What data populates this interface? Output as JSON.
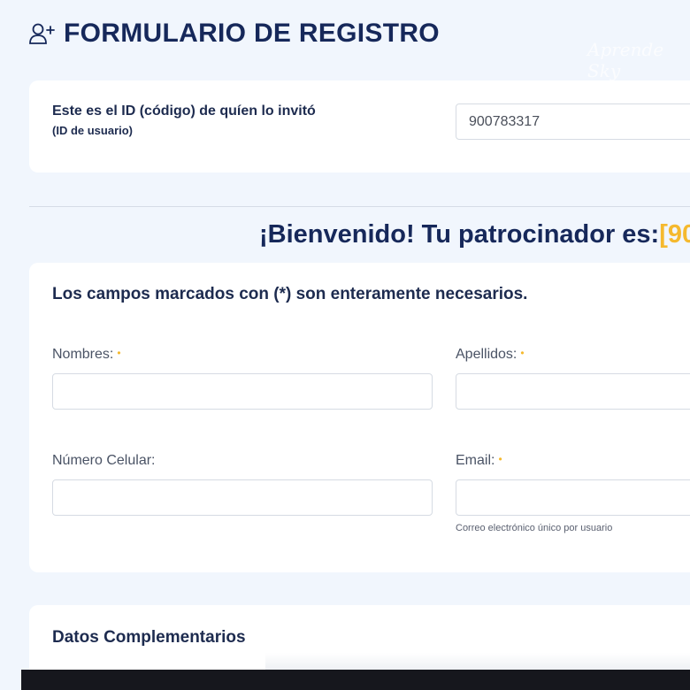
{
  "header": {
    "title": "FORMULARIO DE REGISTRO",
    "icon": "user-plus-icon",
    "watermark": "Aprende Sky"
  },
  "sponsor": {
    "label": "Este es el ID (código) de quíen lo invitó",
    "sublabel": "(ID de usuario)",
    "value": "900783317"
  },
  "welcome": {
    "text": "¡Bienvenido! Tu patrocinador es:",
    "accent": "[90"
  },
  "form": {
    "note": "Los campos marcados con (*) son enteramente necesarios.",
    "required_marker": "•",
    "fields": {
      "nombres": {
        "label": "Nombres:",
        "value": ""
      },
      "apellidos": {
        "label": "Apellidos:",
        "value": ""
      },
      "celular": {
        "label": "Número Celular:",
        "value": ""
      },
      "email": {
        "label": "Email:",
        "value": "",
        "help": "Correo electrónico único por usuario"
      }
    }
  },
  "extra": {
    "title": "Datos Complementarios"
  },
  "colors": {
    "background": "#f1f6fd",
    "primary_text": "#16285a",
    "accent": "#f5b92e"
  }
}
